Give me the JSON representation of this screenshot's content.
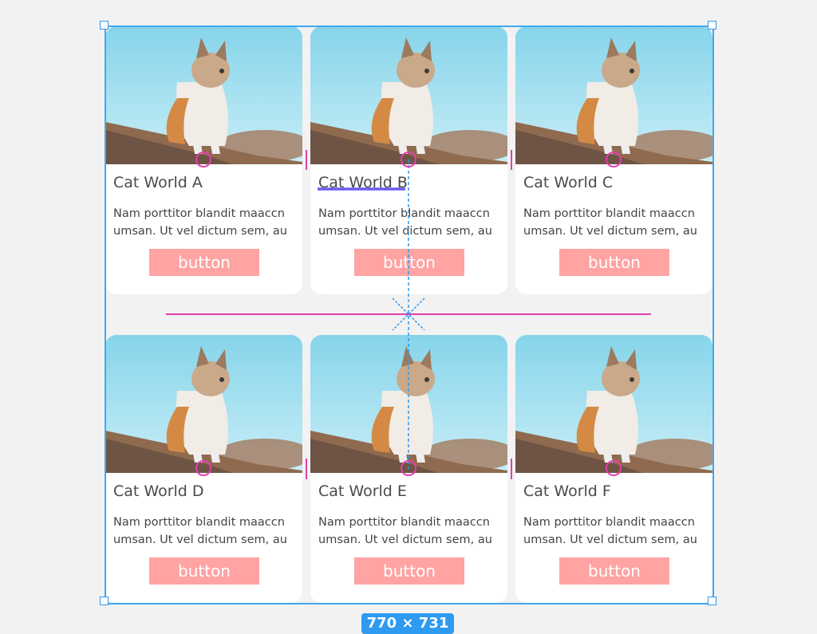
{
  "cards": [
    {
      "title": "Cat World A",
      "description": "Nam porttitor blandit maaccn\numsan. Ut vel dictum sem, au",
      "button_label": "button"
    },
    {
      "title": "Cat World B",
      "description": "Nam porttitor blandit maaccn\numsan. Ut vel dictum sem, au",
      "button_label": "button"
    },
    {
      "title": "Cat World C",
      "description": "Nam porttitor blandit maaccn\numsan. Ut vel dictum sem, au",
      "button_label": "button"
    },
    {
      "title": "Cat World D",
      "description": "Nam porttitor blandit maaccn\numsan. Ut vel dictum sem, au",
      "button_label": "button"
    },
    {
      "title": "Cat World E",
      "description": "Nam porttitor blandit maaccn\numsan. Ut vel dictum sem, au",
      "button_label": "button"
    },
    {
      "title": "Cat World F",
      "description": "Nam porttitor blandit maaccn\numsan. Ut vel dictum sem, au",
      "button_label": "button"
    }
  ],
  "selection": {
    "size_label": "770 × 731"
  },
  "colors": {
    "canvas_background": "#f2f2f2",
    "card_background": "#ffffff",
    "button_fill": "#ffa3a3",
    "selection_blue": "#2e9af0",
    "guide_pink": "#e23fb0",
    "text_underline": "#6b5cf0"
  }
}
